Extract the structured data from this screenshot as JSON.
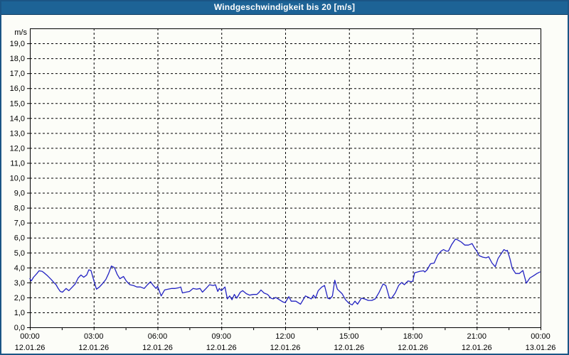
{
  "window": {
    "title": "Windgeschwindigkeit bis 20 [m/s]"
  },
  "colors": {
    "titlebar_bg": "#1d6396",
    "titlebar_text": "#ffffff",
    "frame_border": "#1b5585",
    "background": "#fcfdf8",
    "grid": "#000000",
    "axis": "#000000",
    "line": "#2222c2",
    "label_text": "#000000"
  },
  "chart_data": {
    "type": "line",
    "title": "Windgeschwindigkeit bis 20 [m/s]",
    "ylabel": "m/s",
    "xlabel": "",
    "legend": "none",
    "grid_style": "dashed",
    "y_axis": {
      "min": 0,
      "max": 20,
      "tick_step": 1,
      "unit": "m/s",
      "tick_labels": [
        "0,0",
        "1,0",
        "2,0",
        "3,0",
        "4,0",
        "5,0",
        "6,0",
        "7,0",
        "8,0",
        "9,0",
        "10,0",
        "11,0",
        "12,0",
        "13,0",
        "14,0",
        "15,0",
        "16,0",
        "17,0",
        "18,0",
        "19,0"
      ]
    },
    "x_axis": {
      "range_hours": [
        0,
        24
      ],
      "minor_tick_interval_hours": 1.5,
      "major_tick_hours": [
        0,
        3,
        6,
        9,
        12,
        15,
        18,
        21,
        24
      ],
      "time_labels": [
        "00:00",
        "03:00",
        "06:00",
        "09:00",
        "12:00",
        "15:00",
        "18:00",
        "21:00",
        "00:00"
      ],
      "date_labels": [
        "12.01.26",
        "12.01.26",
        "12.01.26",
        "12.01.26",
        "12.01.26",
        "12.01.26",
        "12.01.26",
        "12.01.26",
        "13.01.26"
      ],
      "gridline_hours": [
        3,
        6,
        9,
        12,
        15,
        18,
        21
      ]
    },
    "series_name": "Windgeschwindigkeit",
    "points": [
      [
        0.0,
        3.25
      ],
      [
        0.07,
        3.1
      ],
      [
        0.17,
        3.35
      ],
      [
        0.33,
        3.6
      ],
      [
        0.43,
        3.78
      ],
      [
        0.57,
        3.75
      ],
      [
        0.67,
        3.65
      ],
      [
        0.83,
        3.45
      ],
      [
        1.0,
        3.2
      ],
      [
        1.13,
        3.0
      ],
      [
        1.23,
        2.85
      ],
      [
        1.33,
        2.6
      ],
      [
        1.43,
        2.4
      ],
      [
        1.53,
        2.35
      ],
      [
        1.63,
        2.5
      ],
      [
        1.7,
        2.6
      ],
      [
        1.83,
        2.45
      ],
      [
        2.0,
        2.7
      ],
      [
        2.13,
        2.9
      ],
      [
        2.27,
        3.3
      ],
      [
        2.4,
        3.5
      ],
      [
        2.53,
        3.35
      ],
      [
        2.67,
        3.5
      ],
      [
        2.77,
        3.85
      ],
      [
        2.87,
        3.8
      ],
      [
        3.0,
        3.15
      ],
      [
        3.13,
        2.55
      ],
      [
        3.27,
        2.7
      ],
      [
        3.4,
        2.9
      ],
      [
        3.57,
        3.2
      ],
      [
        3.7,
        3.6
      ],
      [
        3.83,
        4.1
      ],
      [
        3.97,
        4.0
      ],
      [
        4.1,
        3.55
      ],
      [
        4.23,
        3.25
      ],
      [
        4.4,
        3.4
      ],
      [
        4.53,
        3.1
      ],
      [
        4.7,
        2.85
      ],
      [
        4.87,
        2.8
      ],
      [
        5.03,
        2.7
      ],
      [
        5.2,
        2.7
      ],
      [
        5.37,
        2.6
      ],
      [
        5.53,
        2.85
      ],
      [
        5.67,
        3.05
      ],
      [
        5.8,
        2.8
      ],
      [
        5.93,
        2.6
      ],
      [
        6.0,
        2.75
      ],
      [
        6.17,
        2.1
      ],
      [
        6.33,
        2.5
      ],
      [
        6.5,
        2.55
      ],
      [
        6.67,
        2.6
      ],
      [
        6.83,
        2.6
      ],
      [
        7.0,
        2.65
      ],
      [
        7.09,
        2.7
      ],
      [
        7.17,
        2.3
      ],
      [
        7.33,
        2.35
      ],
      [
        7.5,
        2.4
      ],
      [
        7.67,
        2.6
      ],
      [
        7.83,
        2.55
      ],
      [
        8.0,
        2.6
      ],
      [
        8.11,
        2.35
      ],
      [
        8.28,
        2.6
      ],
      [
        8.44,
        2.85
      ],
      [
        8.61,
        2.8
      ],
      [
        8.72,
        2.85
      ],
      [
        8.83,
        2.4
      ],
      [
        8.9,
        2.6
      ],
      [
        9.0,
        2.45
      ],
      [
        9.17,
        2.7
      ],
      [
        9.28,
        1.9
      ],
      [
        9.39,
        2.1
      ],
      [
        9.5,
        1.85
      ],
      [
        9.61,
        2.2
      ],
      [
        9.72,
        1.95
      ],
      [
        9.89,
        2.35
      ],
      [
        10.0,
        2.45
      ],
      [
        10.17,
        2.25
      ],
      [
        10.33,
        2.15
      ],
      [
        10.5,
        2.2
      ],
      [
        10.67,
        2.2
      ],
      [
        10.78,
        2.35
      ],
      [
        10.86,
        2.5
      ],
      [
        11.0,
        2.3
      ],
      [
        11.17,
        2.2
      ],
      [
        11.33,
        1.95
      ],
      [
        11.44,
        1.9
      ],
      [
        11.56,
        2.0
      ],
      [
        11.72,
        1.85
      ],
      [
        11.89,
        1.7
      ],
      [
        12.0,
        1.65
      ],
      [
        12.17,
        2.05
      ],
      [
        12.28,
        1.75
      ],
      [
        12.5,
        1.75
      ],
      [
        12.72,
        1.55
      ],
      [
        12.95,
        2.1
      ],
      [
        13.1,
        2.0
      ],
      [
        13.22,
        1.9
      ],
      [
        13.33,
        2.15
      ],
      [
        13.42,
        1.95
      ],
      [
        13.55,
        2.45
      ],
      [
        13.72,
        2.7
      ],
      [
        13.85,
        2.8
      ],
      [
        14.0,
        1.95
      ],
      [
        14.1,
        1.9
      ],
      [
        14.22,
        2.1
      ],
      [
        14.33,
        3.15
      ],
      [
        14.45,
        2.55
      ],
      [
        14.67,
        2.25
      ],
      [
        14.83,
        1.85
      ],
      [
        15.0,
        1.6
      ],
      [
        15.15,
        1.5
      ],
      [
        15.28,
        1.75
      ],
      [
        15.4,
        1.55
      ],
      [
        15.58,
        1.95
      ],
      [
        15.73,
        1.9
      ],
      [
        15.9,
        1.8
      ],
      [
        16.07,
        1.8
      ],
      [
        16.23,
        1.9
      ],
      [
        16.4,
        2.3
      ],
      [
        16.6,
        2.9
      ],
      [
        16.73,
        2.8
      ],
      [
        16.9,
        1.95
      ],
      [
        17.0,
        1.95
      ],
      [
        17.17,
        2.3
      ],
      [
        17.33,
        2.8
      ],
      [
        17.47,
        3.0
      ],
      [
        17.6,
        2.85
      ],
      [
        17.77,
        3.1
      ],
      [
        17.93,
        3.05
      ],
      [
        18.0,
        3.1
      ],
      [
        18.08,
        3.65
      ],
      [
        18.33,
        3.75
      ],
      [
        18.5,
        3.78
      ],
      [
        18.56,
        3.7
      ],
      [
        18.67,
        3.85
      ],
      [
        18.83,
        4.25
      ],
      [
        19.0,
        4.3
      ],
      [
        19.17,
        4.85
      ],
      [
        19.33,
        5.1
      ],
      [
        19.44,
        5.2
      ],
      [
        19.56,
        5.1
      ],
      [
        19.67,
        5.1
      ],
      [
        19.83,
        5.55
      ],
      [
        20.0,
        5.9
      ],
      [
        20.11,
        5.85
      ],
      [
        20.28,
        5.7
      ],
      [
        20.44,
        5.5
      ],
      [
        20.61,
        5.5
      ],
      [
        20.78,
        5.6
      ],
      [
        20.9,
        5.3
      ],
      [
        21.0,
        5.1
      ],
      [
        21.11,
        4.8
      ],
      [
        21.28,
        4.7
      ],
      [
        21.44,
        4.65
      ],
      [
        21.56,
        4.72
      ],
      [
        21.72,
        4.3
      ],
      [
        21.87,
        4.05
      ],
      [
        22.0,
        4.6
      ],
      [
        22.28,
        5.2
      ],
      [
        22.39,
        5.1
      ],
      [
        22.44,
        5.15
      ],
      [
        22.56,
        4.6
      ],
      [
        22.67,
        3.95
      ],
      [
        22.83,
        3.6
      ],
      [
        23.0,
        3.6
      ],
      [
        23.17,
        3.8
      ],
      [
        23.33,
        2.95
      ],
      [
        23.5,
        3.3
      ],
      [
        23.67,
        3.45
      ],
      [
        23.83,
        3.6
      ],
      [
        23.97,
        3.7
      ]
    ]
  }
}
